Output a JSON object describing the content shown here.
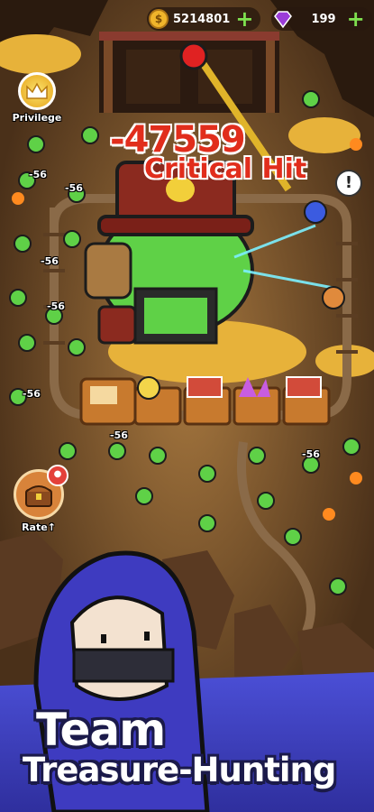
{
  "hud": {
    "coins": "5214801",
    "gems": "199",
    "coin_icon": "gold-coin-icon",
    "gem_icon": "purple-gem-icon",
    "add_icon": "plus-icon"
  },
  "privilege": {
    "label": "Privilege",
    "icon": "crown-icon"
  },
  "rate": {
    "label": "Rate↑",
    "icon": "treasure-chest-icon"
  },
  "battle": {
    "damage": "-47559",
    "critical": "Critical Hit",
    "alert": "!",
    "floating_numbers": [
      "-56",
      "-56",
      "-56",
      "-56",
      "-56",
      "-56",
      "-56"
    ]
  },
  "banner": {
    "line1": "Team",
    "line2": "Treasure-Hunting"
  },
  "colors": {
    "damage": "#e12d1c",
    "gold": "#f0b52b",
    "gem": "#9b3dd8",
    "boss_green": "#5fd147",
    "banner_blue": "#3f3fc6",
    "ground": "#6b4a2b"
  }
}
